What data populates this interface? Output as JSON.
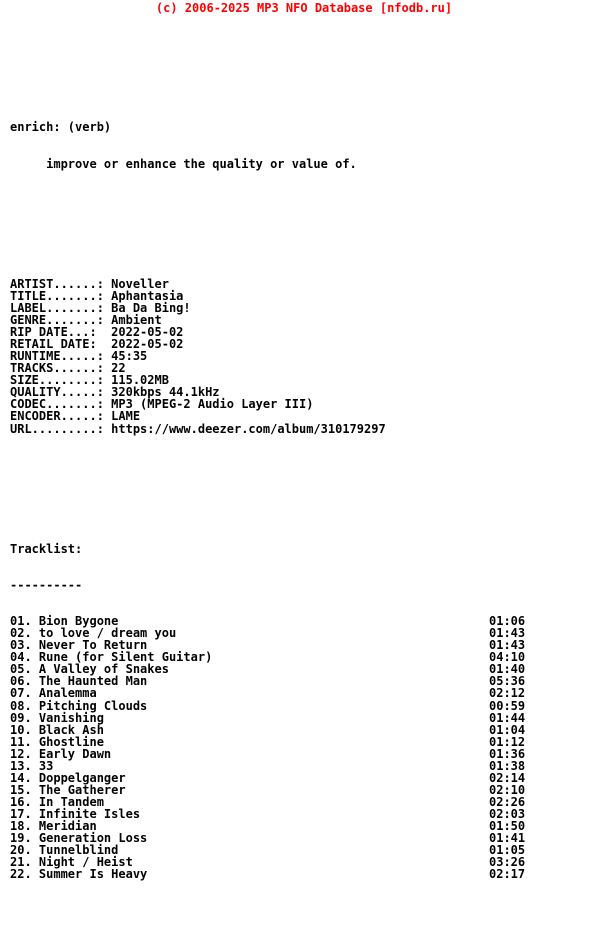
{
  "header": {
    "copyright_line": "(c) 2006-2025 MP3 NFO Database [nfodb.ru]",
    "accent_color": "#ff0000"
  },
  "definition": {
    "term": "enrich: (verb)",
    "description": "     improve or enhance the quality or value of."
  },
  "metadata": {
    "rows": [
      {
        "label": "ARTIST......:",
        "value": "Noveller"
      },
      {
        "label": "TITLE.......:",
        "value": "Aphantasia"
      },
      {
        "label": "LABEL.......:",
        "value": "Ba Da Bing!"
      },
      {
        "label": "GENRE.......:",
        "value": "Ambient"
      },
      {
        "label": "RIP DATE...:",
        "value": "2022-05-02"
      },
      {
        "label": "RETAIL DATE:",
        "value": "2022-05-02"
      },
      {
        "label": "RUNTIME.....:",
        "value": "45:35"
      },
      {
        "label": "TRACKS......:",
        "value": "22"
      },
      {
        "label": "SIZE........:",
        "value": "115.02MB"
      },
      {
        "label": "QUALITY.....:",
        "value": "320kbps 44.1kHz"
      },
      {
        "label": "CODEC.......:",
        "value": "MP3 (MPEG-2 Audio Layer III)"
      },
      {
        "label": "ENCODER.....:",
        "value": "LAME"
      },
      {
        "label": "URL.........:",
        "value": "https://www.deezer.com/album/310179297"
      }
    ]
  },
  "tracklist": {
    "title": "Tracklist:",
    "rule": "----------",
    "tracks": [
      {
        "number": "01.",
        "title": "Bion Bygone",
        "duration": "01:06"
      },
      {
        "number": "02.",
        "title": "to love / dream you",
        "duration": "01:43"
      },
      {
        "number": "03.",
        "title": "Never To Return",
        "duration": "01:43"
      },
      {
        "number": "04.",
        "title": "Rune (for Silent Guitar)",
        "duration": "04:10"
      },
      {
        "number": "05.",
        "title": "A Valley of Snakes",
        "duration": "01:40"
      },
      {
        "number": "06.",
        "title": "The Haunted Man",
        "duration": "05:36"
      },
      {
        "number": "07.",
        "title": "Analemma",
        "duration": "02:12"
      },
      {
        "number": "08.",
        "title": "Pitching Clouds",
        "duration": "00:59"
      },
      {
        "number": "09.",
        "title": "Vanishing",
        "duration": "01:44"
      },
      {
        "number": "10.",
        "title": "Black Ash",
        "duration": "01:04"
      },
      {
        "number": "11.",
        "title": "Ghostline",
        "duration": "01:12"
      },
      {
        "number": "12.",
        "title": "Early Dawn",
        "duration": "01:36"
      },
      {
        "number": "13.",
        "title": "33",
        "duration": "01:38"
      },
      {
        "number": "14.",
        "title": "Doppelganger",
        "duration": "02:14"
      },
      {
        "number": "15.",
        "title": "The Gatherer",
        "duration": "02:10"
      },
      {
        "number": "16.",
        "title": "In Tandem",
        "duration": "02:26"
      },
      {
        "number": "17.",
        "title": "Infinite Isles",
        "duration": "02:03"
      },
      {
        "number": "18.",
        "title": "Meridian",
        "duration": "01:50"
      },
      {
        "number": "19.",
        "title": "Generation Loss",
        "duration": "01:41"
      },
      {
        "number": "20.",
        "title": "Tunnelblind",
        "duration": "01:05"
      },
      {
        "number": "21.",
        "title": "Night / Heist",
        "duration": "03:26"
      },
      {
        "number": "22.",
        "title": "Summer Is Heavy",
        "duration": "02:17"
      }
    ]
  }
}
